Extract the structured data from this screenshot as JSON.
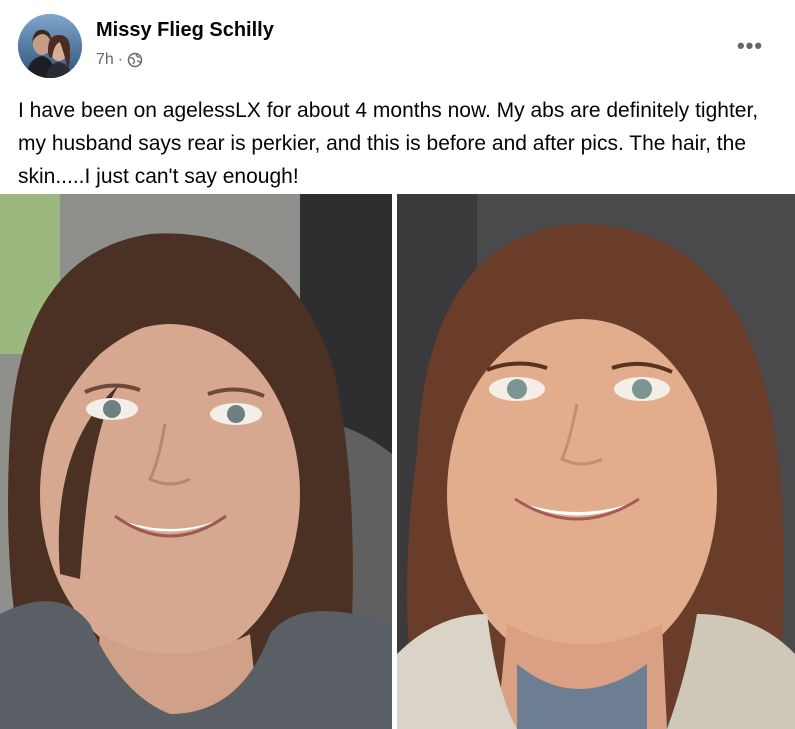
{
  "post": {
    "author_name": "Missy Flieg Schilly",
    "timestamp": "7h",
    "separator": "·",
    "audience_icon": "globe-icon",
    "more_icon": "more-options-icon",
    "more_label": "•••",
    "text": "I have been on agelessLX for about 4 months now. My abs are definitely tighter, my husband says  rear is perkier, and this is before and after pics. The hair, the skin.....I just can't say enough!"
  },
  "colors": {
    "text_primary": "#050505",
    "text_secondary": "#65676b",
    "background": "#ffffff"
  }
}
